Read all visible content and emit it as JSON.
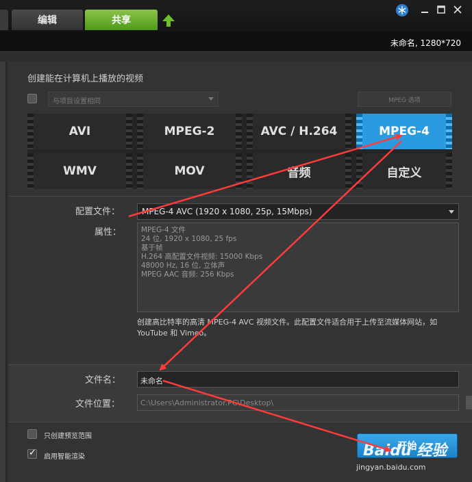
{
  "tabs": {
    "edit": "编辑",
    "share": "共享"
  },
  "project_info": "未命名, 1280*720",
  "heading": "创建能在计算机上播放的视频",
  "same_as_project": "与项目设置相同",
  "mpeg_options": "MPEG 选项",
  "formats": [
    {
      "label": "AVI",
      "selected": false
    },
    {
      "label": "MPEG-2",
      "selected": false
    },
    {
      "label": "AVC / H.264",
      "selected": false
    },
    {
      "label": "MPEG-4",
      "selected": true
    },
    {
      "label": "WMV",
      "selected": false
    },
    {
      "label": "MOV",
      "selected": false
    },
    {
      "label": "音频",
      "selected": false
    },
    {
      "label": "自定义",
      "selected": false
    }
  ],
  "profile": {
    "label": "配置文件：",
    "value": "MPEG-4 AVC (1920 x 1080, 25p, 15Mbps)"
  },
  "properties": {
    "label": "属性：",
    "lines": [
      "MPEG-4 文件",
      "24 位, 1920 x 1080, 25 fps",
      "基于帧",
      "H.264 高配置文件视频: 15000 Kbps",
      "48000 Hz, 16 位, 立体声",
      "MPEG AAC 音频: 256 Kbps"
    ]
  },
  "description": "创建高比特率的高清 MPEG-4 AVC 视频文件。此配置文件适合用于上传至流媒体网站，如 YouTube 和 Vimeo。",
  "filename": {
    "label": "文件名：",
    "value": "未命名"
  },
  "location": {
    "label": "文件位置：",
    "value": "C:\\Users\\Administrator.PC\\Desktop\\"
  },
  "options": {
    "preview_range": "只创建预览范围",
    "smart_render": "启用智能渲染",
    "smart_render_checked": true
  },
  "start_button": "开始",
  "watermark": {
    "logo": "Baidu 经验",
    "url": "jingyan.baidu.com"
  },
  "colors": {
    "accent": "#2a9be0",
    "share_tab": "#5fae24",
    "arrow": "#ff3b3b"
  }
}
